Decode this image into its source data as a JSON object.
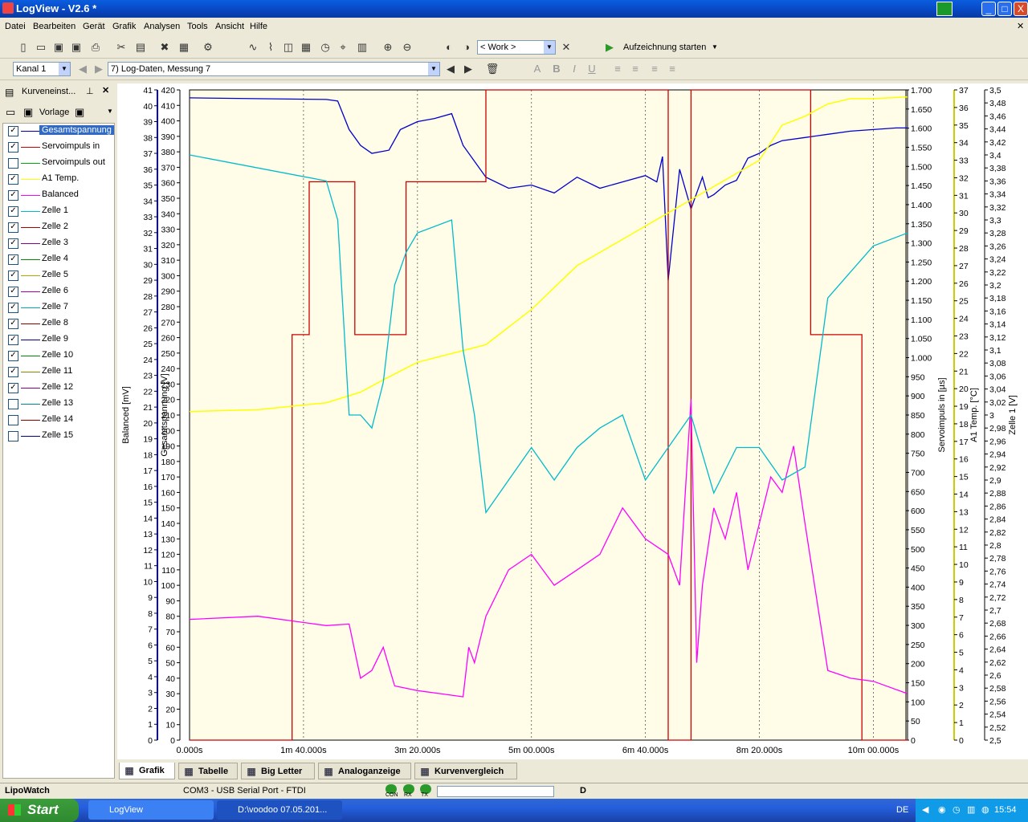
{
  "window": {
    "title": "LogView - V2.6 *",
    "min": "_",
    "max": "□",
    "close": "X"
  },
  "menu": [
    "Datei",
    "Bearbeiten",
    "Gerät",
    "Grafik",
    "Analysen",
    "Tools",
    "Ansicht",
    "Hilfe"
  ],
  "toolbar1": {
    "work_combo": "< Work >",
    "record_label": "Aufzeichnung starten"
  },
  "toolbar2": {
    "channel_combo": "Kanal 1",
    "log_combo": "7) Log-Daten, Messung 7",
    "bold": "B",
    "italic": "I",
    "underline": "U",
    "font": "A"
  },
  "sidebar": {
    "title": "Kurveneinst...",
    "vorlage": "Vorlage",
    "items": [
      {
        "label": "Gesamtspannung",
        "checked": true,
        "color": "#0000aa",
        "selected": true
      },
      {
        "label": "Servoimpuls in",
        "checked": true,
        "color": "#cc0000"
      },
      {
        "label": "Servoimpuls out",
        "checked": false,
        "color": "#00aa00"
      },
      {
        "label": "A1 Temp.",
        "checked": true,
        "color": "#ffff00"
      },
      {
        "label": "Balanced",
        "checked": true,
        "color": "#ff00ff"
      },
      {
        "label": "Zelle 1",
        "checked": true,
        "color": "#00bbcc"
      },
      {
        "label": "Zelle 2",
        "checked": true,
        "color": "#aa0000"
      },
      {
        "label": "Zelle 3",
        "checked": true,
        "color": "#880088"
      },
      {
        "label": "Zelle 4",
        "checked": true,
        "color": "#008800"
      },
      {
        "label": "Zelle 5",
        "checked": true,
        "color": "#aaaa00"
      },
      {
        "label": "Zelle 6",
        "checked": true,
        "color": "#aa00aa"
      },
      {
        "label": "Zelle 7",
        "checked": true,
        "color": "#00aaaa"
      },
      {
        "label": "Zelle 8",
        "checked": true,
        "color": "#880000"
      },
      {
        "label": "Zelle 9",
        "checked": true,
        "color": "#000088"
      },
      {
        "label": "Zelle 10",
        "checked": true,
        "color": "#008800"
      },
      {
        "label": "Zelle 11",
        "checked": true,
        "color": "#888800"
      },
      {
        "label": "Zelle 12",
        "checked": true,
        "color": "#880088"
      },
      {
        "label": "Zelle 13",
        "checked": false,
        "color": "#008888"
      },
      {
        "label": "Zelle 14",
        "checked": false,
        "color": "#880000"
      },
      {
        "label": "Zelle 15",
        "checked": false,
        "color": "#000088"
      }
    ]
  },
  "chart_data": {
    "type": "line",
    "x_label_ticks": [
      "0.000s",
      "1m 40.000s",
      "3m 20.000s",
      "5m 00.000s",
      "6m 40.000s",
      "8m 20.000s",
      "10m 00.000s"
    ],
    "xlim": [
      0,
      630
    ],
    "axes": [
      {
        "name": "Balanced [mV]",
        "ylim": [
          0,
          420
        ],
        "ticks": [
          0,
          10,
          20,
          30,
          40,
          50,
          60,
          70,
          80,
          90,
          100,
          110,
          120,
          130,
          140,
          150,
          160,
          170,
          180,
          190,
          200,
          210,
          220,
          230,
          240,
          250,
          260,
          270,
          280,
          290,
          300,
          310,
          320,
          330,
          340,
          350,
          360,
          370,
          380,
          390,
          400,
          410,
          420
        ],
        "side": "left",
        "color": "#000000"
      },
      {
        "name": "Gesamtspannung [V]",
        "ylim": [
          0,
          41
        ],
        "ticks": [
          0,
          1,
          2,
          3,
          4,
          5,
          6,
          7,
          8,
          9,
          10,
          11,
          12,
          13,
          14,
          15,
          16,
          17,
          18,
          19,
          20,
          21,
          22,
          23,
          24,
          25,
          26,
          27,
          28,
          29,
          30,
          31,
          32,
          33,
          34,
          35,
          36,
          37,
          38,
          39,
          40,
          41
        ],
        "side": "left",
        "color": "#0000cc"
      },
      {
        "name": "Servoimpuls in [µs]",
        "ylim": [
          0,
          1700
        ],
        "ticks": [
          "0",
          "50",
          "100",
          "150",
          "200",
          "250",
          "300",
          "350",
          "400",
          "450",
          "500",
          "550",
          "600",
          "650",
          "700",
          "750",
          "800",
          "850",
          "900",
          "950",
          "1.000",
          "1.050",
          "1.100",
          "1.150",
          "1.200",
          "1.250",
          "1.300",
          "1.350",
          "1.400",
          "1.450",
          "1.500",
          "1.550",
          "1.600",
          "1.650",
          "1.700"
        ],
        "side": "right",
        "color": "#000000"
      },
      {
        "name": "A1 Temp. [°C]",
        "ylim": [
          0,
          37
        ],
        "ticks": [
          0,
          1,
          2,
          3,
          4,
          5,
          6,
          7,
          8,
          9,
          10,
          11,
          12,
          13,
          14,
          15,
          16,
          17,
          18,
          19,
          20,
          21,
          22,
          23,
          24,
          25,
          26,
          27,
          28,
          29,
          30,
          31,
          32,
          33,
          34,
          35,
          36,
          37
        ],
        "side": "right",
        "color": "#cccc00"
      },
      {
        "name": "Zelle 1 [V]",
        "ylim": [
          2.5,
          3.5
        ],
        "ticks": [
          "2,5",
          "2,52",
          "2,54",
          "2,56",
          "2,58",
          "2,6",
          "2,62",
          "2,64",
          "2,66",
          "2,68",
          "2,7",
          "2,72",
          "2,74",
          "2,76",
          "2,78",
          "2,8",
          "2,82",
          "2,84",
          "2,86",
          "2,88",
          "2,9",
          "2,92",
          "2,94",
          "2,96",
          "2,98",
          "3",
          "3,02",
          "3,04",
          "3,06",
          "3,08",
          "3,1",
          "3,12",
          "3,14",
          "3,16",
          "3,18",
          "3,2",
          "3,22",
          "3,24",
          "3,26",
          "3,28",
          "3,3",
          "3,32",
          "3,34",
          "3,36",
          "3,38",
          "3,4",
          "3,42",
          "3,44",
          "3,46",
          "3,48",
          "3,5"
        ],
        "side": "right",
        "color": "#000000"
      }
    ],
    "series": [
      {
        "name": "Gesamtspannung",
        "color": "#0000cc",
        "x": [
          0,
          120,
          130,
          140,
          150,
          160,
          175,
          185,
          200,
          215,
          230,
          240,
          260,
          280,
          300,
          320,
          340,
          360,
          380,
          400,
          410,
          415,
          420,
          430,
          440,
          450,
          455,
          460,
          470,
          480,
          490,
          500,
          510,
          520,
          540,
          560,
          580,
          600,
          620,
          630
        ],
        "y": [
          40.5,
          40.4,
          40.3,
          38.5,
          37.5,
          37.0,
          37.2,
          38.5,
          39.0,
          39.2,
          39.5,
          37.5,
          35.5,
          34.8,
          35.0,
          34.5,
          35.5,
          34.8,
          35.2,
          35.6,
          35.2,
          36.8,
          29.0,
          36.0,
          33.5,
          35.5,
          34.2,
          34.4,
          35.0,
          35.3,
          36.7,
          37.0,
          37.5,
          37.8,
          38.0,
          38.2,
          38.4,
          38.5,
          38.6,
          38.6
        ]
      },
      {
        "name": "Servoimpuls in",
        "color": "#cc0000",
        "x": [
          0,
          90,
          90,
          105,
          105,
          145,
          145,
          190,
          190,
          260,
          260,
          420,
          420,
          440,
          440,
          545,
          545,
          590,
          590,
          630
        ],
        "y": [
          0,
          0,
          1060,
          1060,
          1460,
          1460,
          1060,
          1060,
          1460,
          1460,
          1700,
          1700,
          0,
          0,
          1700,
          1700,
          1060,
          1060,
          0,
          0
        ]
      },
      {
        "name": "A1 Temp.",
        "color": "#ffff00",
        "x": [
          0,
          60,
          120,
          150,
          170,
          200,
          230,
          260,
          300,
          340,
          380,
          420,
          460,
          500,
          520,
          540,
          560,
          580,
          600,
          630
        ],
        "y": [
          18.7,
          18.8,
          19.2,
          19.8,
          20.5,
          21.5,
          22.0,
          22.5,
          24.5,
          27.0,
          28.5,
          30.0,
          31.5,
          33.0,
          35.0,
          35.5,
          36.2,
          36.5,
          36.5,
          36.6
        ]
      },
      {
        "name": "Balanced",
        "color": "#ff00ff",
        "x": [
          0,
          60,
          120,
          140,
          150,
          160,
          170,
          180,
          200,
          220,
          240,
          245,
          250,
          260,
          280,
          300,
          320,
          340,
          360,
          380,
          400,
          420,
          430,
          440,
          445,
          450,
          460,
          470,
          480,
          490,
          500,
          510,
          520,
          530,
          540,
          560,
          580,
          600,
          630
        ],
        "y": [
          78,
          80,
          74,
          75,
          40,
          45,
          60,
          35,
          32,
          30,
          28,
          60,
          50,
          80,
          110,
          120,
          100,
          110,
          120,
          150,
          130,
          120,
          100,
          220,
          50,
          100,
          150,
          130,
          160,
          110,
          140,
          170,
          160,
          190,
          140,
          45,
          40,
          38,
          30
        ]
      },
      {
        "name": "Zelle 1",
        "color": "#00bbcc",
        "x": [
          0,
          120,
          130,
          140,
          150,
          160,
          170,
          180,
          190,
          200,
          230,
          240,
          250,
          260,
          280,
          300,
          320,
          340,
          360,
          380,
          400,
          420,
          440,
          460,
          480,
          500,
          520,
          540,
          560,
          580,
          600,
          630
        ],
        "y": [
          3.4,
          3.36,
          3.3,
          3.0,
          3.0,
          2.98,
          3.05,
          3.2,
          3.25,
          3.28,
          3.3,
          3.1,
          3.0,
          2.85,
          2.9,
          2.95,
          2.9,
          2.95,
          2.98,
          3.0,
          2.9,
          2.95,
          3.0,
          2.88,
          2.95,
          2.95,
          2.9,
          2.92,
          3.18,
          3.22,
          3.26,
          3.28
        ]
      }
    ]
  },
  "tabs": [
    {
      "label": "Grafik",
      "active": true,
      "icon": "graph-icon"
    },
    {
      "label": "Tabelle",
      "icon": "table-icon"
    },
    {
      "label": "Big Letter",
      "icon": "big-letter-icon"
    },
    {
      "label": "Analoganzeige",
      "icon": "gauge-icon"
    },
    {
      "label": "Kurvenvergleich",
      "icon": "curve-compare-icon"
    }
  ],
  "status": {
    "device": "LipoWatch",
    "port": "COM3  -  USB Serial Port  -  FTDI",
    "con": "CON",
    "rx": "RX",
    "tx": "TX",
    "d": "D"
  },
  "taskbar": {
    "start": "Start",
    "task1": "LogView",
    "task2": "D:\\voodoo 07.05.201...",
    "lang": "DE",
    "time": "15:54"
  }
}
